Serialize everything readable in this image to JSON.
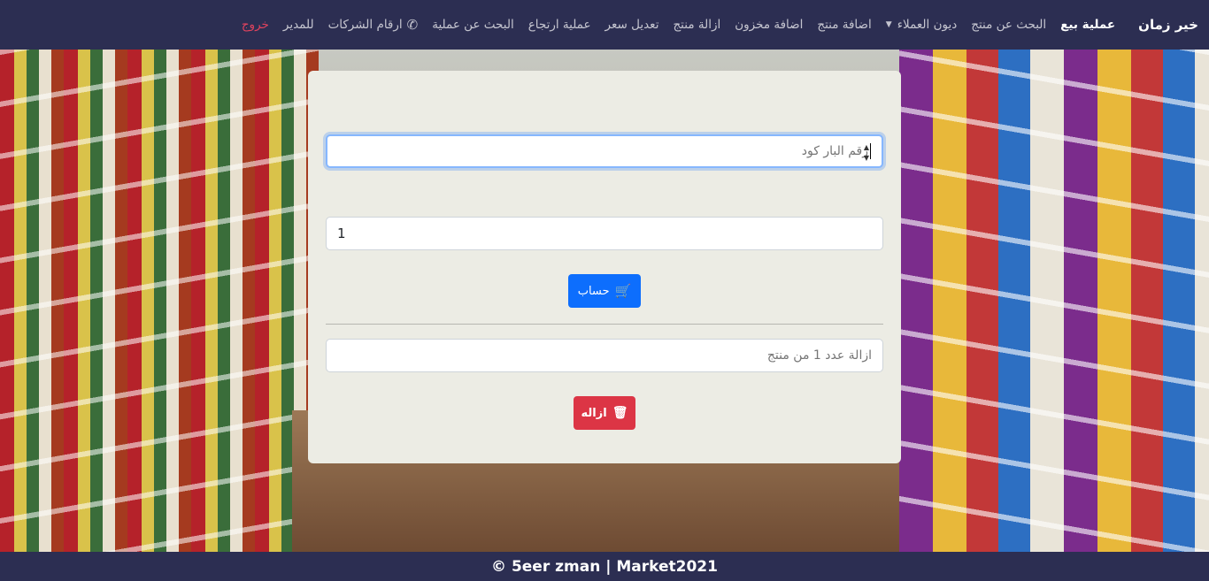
{
  "navbar": {
    "brand": "خير زمان",
    "links": [
      {
        "label": "عملية بيع",
        "active": true
      },
      {
        "label": "البحث عن منتج"
      },
      {
        "label": "ديون العملاء",
        "dropdown": true
      },
      {
        "label": "اضافة منتج"
      },
      {
        "label": "اضافة مخزون"
      },
      {
        "label": "ازالة منتج"
      },
      {
        "label": "تعديل سعر"
      },
      {
        "label": "عملية ارتجاع"
      },
      {
        "label": "البحث عن عملية"
      },
      {
        "label": "ارقام الشركات",
        "icon": "phone-icon"
      },
      {
        "label": "للمدير"
      },
      {
        "label": "خروج"
      }
    ]
  },
  "form": {
    "barcode_placeholder": "رقم البار كود",
    "quantity_value": "1",
    "calc_button": "حساب",
    "remove_placeholder": "ازالة عدد 1 من منتج",
    "remove_button": "ازاله"
  },
  "footer": {
    "text": "© 5eer zman | Market2021"
  },
  "colors": {
    "navbar": "#2c2e52",
    "primary": "#0d6efd",
    "danger": "#dc3545",
    "logout": "#e0435e",
    "panel": "#ecece4"
  }
}
